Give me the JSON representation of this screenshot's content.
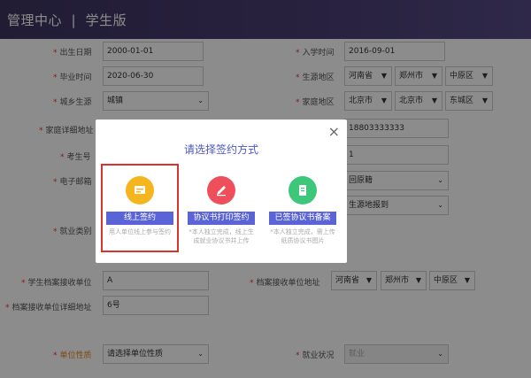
{
  "header": {
    "title": "管理中心  |  学生版"
  },
  "form": {
    "birth_date": {
      "label": "出生日期",
      "value": "2000-01-01"
    },
    "enroll_date": {
      "label": "入学时间",
      "value": "2016-09-01"
    },
    "grad_date": {
      "label": "毕业时间",
      "value": "2020-06-30"
    },
    "origin": {
      "label": "生源地区",
      "province": "河南省",
      "city": "郑州市",
      "district": "中原区"
    },
    "urban_rural": {
      "label": "城乡生源",
      "value": "城镇"
    },
    "home": {
      "label": "家庭地区",
      "province": "北京市",
      "city": "北京市",
      "district": "东城区"
    },
    "home_detail_label": "家庭详细地址",
    "phone_value": "18803333333",
    "exam_no_label": "考生号",
    "exam_no_value": "1",
    "email_label": "电子邮箱",
    "return_value": "回原籍",
    "origin_report_value": "生源地报到",
    "employment_type_label": "就业类别",
    "archive_unit": {
      "label": "学生档案接收单位",
      "value": "A"
    },
    "archive_address": {
      "label": "档案接收单位地址",
      "province": "河南省",
      "city": "郑州市",
      "district": "中原区"
    },
    "archive_detail": {
      "label": "档案接收单位详细地址",
      "value": "6号"
    },
    "unit_nature": {
      "label": "单位性质",
      "value": "请选择单位性质"
    },
    "employment_status": {
      "label": "就业状况",
      "value": "就业"
    }
  },
  "modal": {
    "title": "请选择签约方式",
    "close": "×",
    "options": [
      {
        "button": "线上签约",
        "desc": "用人单位线上参与签约",
        "icon": "document-icon",
        "color": "#f5b51f"
      },
      {
        "button": "协议书打印签约",
        "desc": "*本人独立完成，线上生成就业协议书并上传",
        "icon": "pen-icon",
        "color": "#ef4f5a"
      },
      {
        "button": "已签协议书备案",
        "desc": "*本人独立完成，需上传纸质协议书图片",
        "icon": "file-icon",
        "color": "#3cc77a"
      }
    ]
  }
}
